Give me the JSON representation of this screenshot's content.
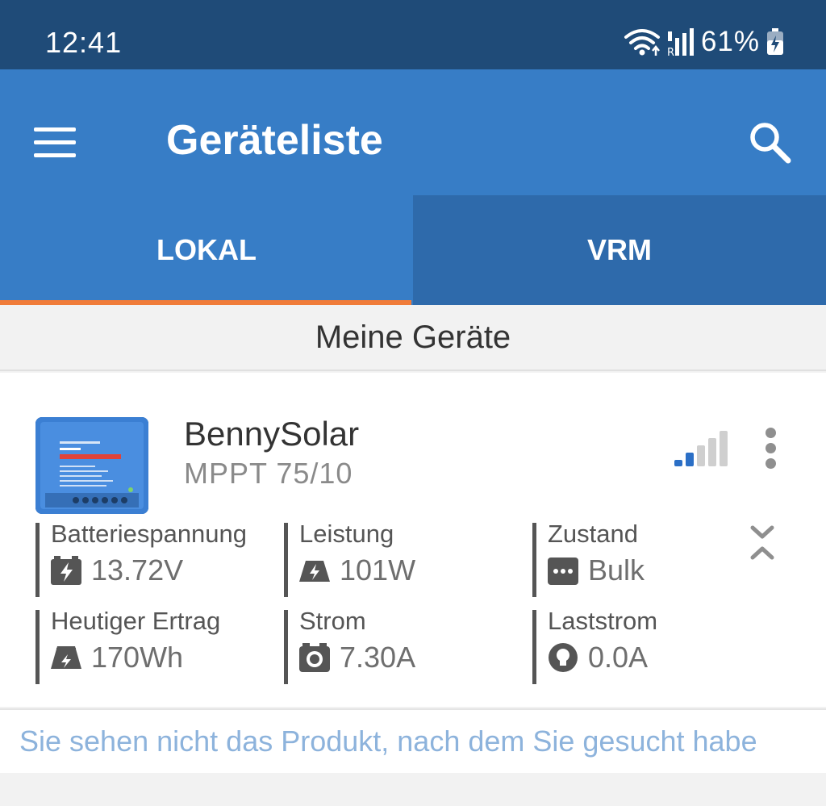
{
  "status": {
    "time": "12:41",
    "battery": "61%",
    "icons": [
      "wifi-icon",
      "signal-icon",
      "battery-icon"
    ]
  },
  "appbar": {
    "title": "Geräteliste",
    "icons": [
      "menu-icon",
      "search-icon"
    ]
  },
  "tabs": [
    {
      "label": "LOKAL",
      "active": true
    },
    {
      "label": "VRM",
      "active": false
    }
  ],
  "section": {
    "title": "Meine Geräte"
  },
  "device": {
    "name": "BennySolar",
    "model": "MPPT 75/10",
    "signal_bars_active": 2,
    "signal_bars_total": 5,
    "metrics": [
      {
        "label": "Batteriespannung",
        "value": "13.72V",
        "icon": "battery-charge-icon"
      },
      {
        "label": "Leistung",
        "value": "101W",
        "icon": "solar-panel-icon"
      },
      {
        "label": "Zustand",
        "value": "Bulk",
        "icon": "status-dots-icon"
      },
      {
        "label": "Heutiger Ertrag",
        "value": "170Wh",
        "icon": "today-yield-icon"
      },
      {
        "label": "Strom",
        "value": "7.30A",
        "icon": "current-meter-icon"
      },
      {
        "label": "Laststrom",
        "value": "0.0A",
        "icon": "bulb-icon"
      }
    ]
  },
  "bottom_link": "Sie sehen nicht das Produkt, nach dem Sie gesucht habe",
  "colors": {
    "statusbar": "#1f4b78",
    "appbar": "#377dc6",
    "tab_inactive": "#2e6aab",
    "tab_indicator": "#f07c3a",
    "link": "#8db3dc",
    "signal_active": "#2b6fc6",
    "signal_inactive": "#cfcfcf"
  }
}
